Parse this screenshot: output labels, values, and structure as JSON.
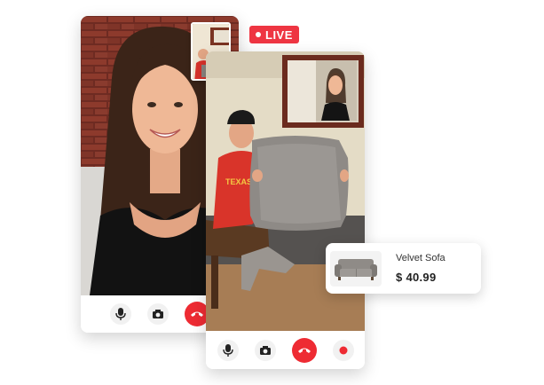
{
  "live_badge": {
    "label": "LIVE",
    "color": "#ee3542"
  },
  "left_call": {
    "controls": [
      {
        "icon": "microphone-icon",
        "kind": "mic"
      },
      {
        "icon": "camera-icon",
        "kind": "camera"
      },
      {
        "icon": "end-call-icon",
        "kind": "end"
      }
    ]
  },
  "right_call": {
    "controls": [
      {
        "icon": "microphone-icon",
        "kind": "mic"
      },
      {
        "icon": "camera-icon",
        "kind": "camera"
      },
      {
        "icon": "end-call-icon",
        "kind": "end"
      },
      {
        "icon": "record-icon",
        "kind": "record"
      }
    ]
  },
  "product": {
    "name": "Velvet Sofa",
    "price": "$ 40.99",
    "icon": "sofa-icon"
  },
  "colors": {
    "end_call": "#ee2b33",
    "record": "#ee2b33",
    "control_bg": "#f1f1f1"
  }
}
